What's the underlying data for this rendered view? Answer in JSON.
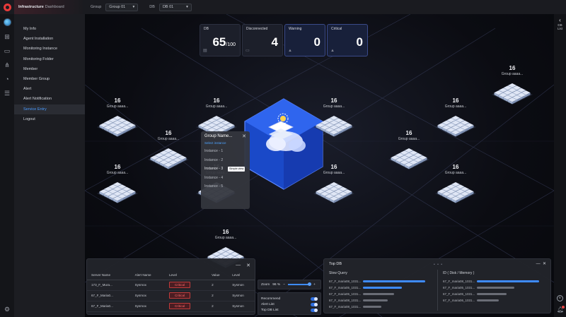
{
  "app": {
    "title_bold": "Infrastructure",
    "title_rest": " Dashboard"
  },
  "filters": {
    "group_label": "Group",
    "group_value": "Group 01",
    "db_label": "DB",
    "db_value": "DB 01"
  },
  "menu": [
    "My Info",
    "Agent Installation",
    "Monitoring Instance",
    "Monitoring Folder",
    "Member",
    "Member Group",
    "Alert",
    "Alert Notification",
    "Service Entry",
    "Logout"
  ],
  "menu_active_index": 8,
  "right_rail": {
    "db_list_label": "DB List"
  },
  "stats": [
    {
      "label": "DB",
      "value": "65",
      "total": "/100",
      "icon": "database-icon"
    },
    {
      "label": "Disconnected",
      "value": "4",
      "icon": "disconnect-icon"
    },
    {
      "label": "Warning",
      "value": "0",
      "icon": "warning-icon"
    },
    {
      "label": "Critical",
      "value": "0",
      "icon": "critical-icon"
    }
  ],
  "groups": [
    {
      "count": "16",
      "name": "Group aaaa..."
    },
    {
      "count": "16",
      "name": "Group aaaa..."
    },
    {
      "count": "16",
      "name": "Group aaaa..."
    },
    {
      "count": "16",
      "name": "Group aaaa..."
    },
    {
      "count": "16",
      "name": "Group aaaa..."
    },
    {
      "count": "16",
      "name": "Group aaaa..."
    },
    {
      "count": "16",
      "name": "Group aaaa..."
    },
    {
      "count": "16",
      "name": "Group aaaa..."
    },
    {
      "count": "16",
      "name": "Group aaaa..."
    },
    {
      "count": "16",
      "name": "Group aaaa..."
    },
    {
      "count": "16",
      "name": "Group aaaa..."
    },
    {
      "count": "16",
      "name": "Group aaaa..."
    }
  ],
  "popup": {
    "title": "Group Name...",
    "subtitle": "Select instance",
    "instances": [
      "Instance - 1",
      "Instance - 2",
      "Instance - 3",
      "Instance - 4",
      "Instance - 5"
    ],
    "selected_index": 2,
    "tooltip": "Simple view"
  },
  "alert_table": {
    "columns": [
      "Server Name",
      "Alert Name",
      "Level",
      "Value",
      "Level"
    ],
    "rows": [
      [
        "173_F_Mura...",
        "Sysmox",
        "Critical",
        "2",
        "Sysmon"
      ],
      [
        "67_F_Maria0...",
        "Sysmox",
        "Critical",
        "2",
        "Sysmon"
      ],
      [
        "67_F_Maria0...",
        "Sysmox",
        "Critical",
        "2",
        "Sysmon"
      ]
    ]
  },
  "zoom": {
    "label": "Zoom",
    "value": "96 %",
    "minus": "−",
    "plus": "+",
    "level": 0.96
  },
  "toggles": [
    {
      "label": "Recommend",
      "on": true
    },
    {
      "label": "Alert List",
      "on": true
    },
    {
      "label": "Top DB List",
      "on": true
    }
  ],
  "top_db": {
    "title": "Top DB",
    "dots": "• • •",
    "left_header": "Slow Query",
    "right_header": "ID ( Disk / Memory )",
    "left_rows": [
      {
        "name": "67_F_maria08_1031...",
        "value": 1.0,
        "hot": true
      },
      {
        "name": "67_F_maria05_1031...",
        "value": 0.62,
        "hot": true
      },
      {
        "name": "67_F_maria05_1031...",
        "value": 0.5,
        "hot": false
      },
      {
        "name": "67_F_maria08_1031...",
        "value": 0.4,
        "hot": false
      },
      {
        "name": "67_F_maria08_1031...",
        "value": 0.3,
        "hot": false
      }
    ],
    "right_rows": [
      {
        "name": "67_F_maria08_1031...",
        "value": 1.0,
        "hot": true
      },
      {
        "name": "67_F_maria05_1031...",
        "value": 0.6,
        "hot": false
      },
      {
        "name": "67_F_maria05_1031...",
        "value": 0.48,
        "hot": false
      },
      {
        "name": "67_F_maria06_1031...",
        "value": 0.35,
        "hot": false
      }
    ]
  }
}
